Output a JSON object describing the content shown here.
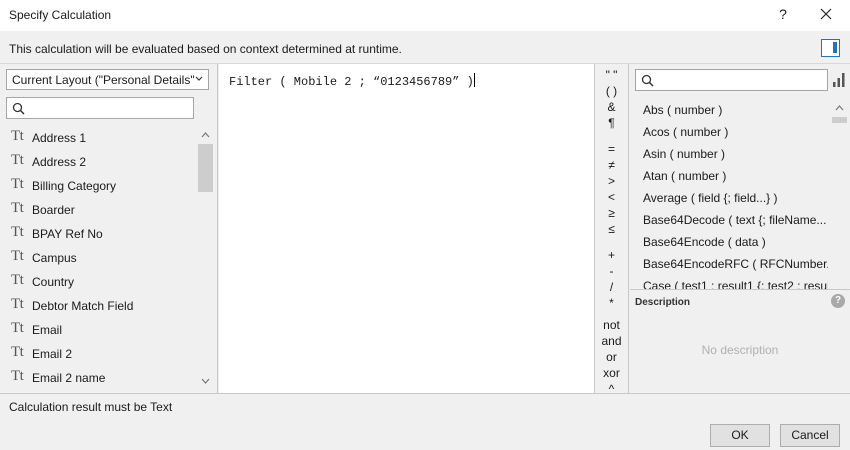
{
  "window": {
    "title": "Specify Calculation",
    "help_label": "?"
  },
  "info": {
    "message": "This calculation will be evaluated based on context determined at runtime."
  },
  "left": {
    "layout_selected": "Current Layout (\"Personal Details\"",
    "field_type_glyph": "Tt",
    "fields": [
      "Address 1",
      "Address 2",
      "Billing Category",
      "Boarder",
      "BPAY Ref No",
      "Campus",
      "Country",
      "Debtor Match Field",
      "Email",
      "Email 2",
      "Email 2 name"
    ]
  },
  "editor": {
    "formula": "Filter ( Mobile 2 ; “0123456789” )"
  },
  "operators": [
    "\" \"",
    "( )",
    "&",
    "¶",
    "=",
    "≠",
    ">",
    "<",
    "≥",
    "≤",
    "+",
    "-",
    "/",
    "*",
    "not",
    "and",
    "or",
    "xor",
    "^"
  ],
  "right": {
    "functions": [
      "Abs ( number )",
      "Acos ( number )",
      "Asin ( number )",
      "Atan ( number )",
      "Average ( field {; field...} )",
      "Base64Decode ( text {; fileName...",
      "Base64Encode ( data )",
      "Base64EncodeRFC ( RFCNumber...",
      "Case ( test1 ; result1 {; test2 ; resul..."
    ],
    "description_label": "Description",
    "description_help": "?",
    "no_description": "No description"
  },
  "footer": {
    "result_text": "Calculation result must be Text",
    "ok_label": "OK",
    "cancel_label": "Cancel"
  },
  "colors": {
    "accent": "#1e73c4",
    "panel": "#f0f0f0"
  }
}
